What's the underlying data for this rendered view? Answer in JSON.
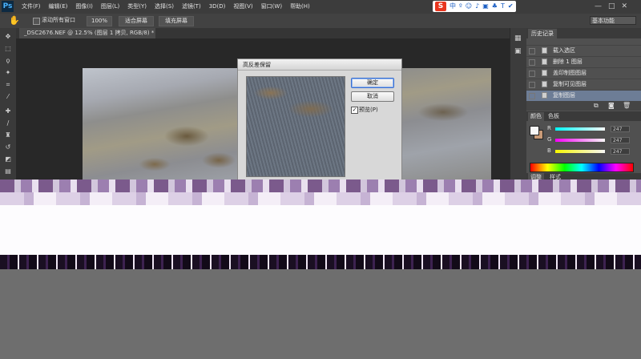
{
  "app": {
    "logo": "Ps"
  },
  "menu": [
    "文件(F)",
    "编辑(E)",
    "图像(I)",
    "图层(L)",
    "类型(Y)",
    "选择(S)",
    "滤镜(T)",
    "3D(D)",
    "视图(V)",
    "窗口(W)",
    "帮助(H)"
  ],
  "ime": {
    "logo": "S",
    "items": [
      "中",
      "º",
      "☺",
      "♪",
      "▣",
      "♣",
      "T",
      "✔"
    ]
  },
  "window_controls": [
    "—",
    "□",
    "✕"
  ],
  "options": {
    "scroll_all_label": "滚动所有窗口",
    "scroll_all_checked": false,
    "btn_100": "100%",
    "btn_fit": "适合屏幕",
    "btn_fill": "填充屏幕",
    "workspace": "基本功能"
  },
  "document": {
    "tab_title": "_DSC2676.NEF @ 12.5% (图层 1 拷贝, RGB/8) *"
  },
  "dialog": {
    "title": "高反差保留",
    "ok": "确定",
    "cancel": "取消",
    "preview_label": "预览(P)",
    "preview_checked": true
  },
  "history": {
    "tab": "历史记录",
    "items": [
      {
        "label": "载入选区",
        "selected": false
      },
      {
        "label": "删除 1 图层",
        "selected": false
      },
      {
        "label": "盖印制图图层",
        "selected": false
      },
      {
        "label": "复制可见图层",
        "selected": false
      },
      {
        "label": "复制图层",
        "selected": true
      }
    ]
  },
  "color": {
    "tab": "颜色",
    "tab2": "色板",
    "fg": "#f7f7f7",
    "bg": "#c89a77",
    "channels": [
      {
        "label": "R",
        "value": "247"
      },
      {
        "label": "G",
        "value": "247"
      },
      {
        "label": "B",
        "value": "247"
      }
    ]
  },
  "adjust": {
    "tab": "调整",
    "tab2": "样式"
  },
  "colors": {
    "menubar": "#3c3c3c",
    "panel": "#505050",
    "selected": "#6d7d96",
    "dialog": "#d8d8d8"
  }
}
